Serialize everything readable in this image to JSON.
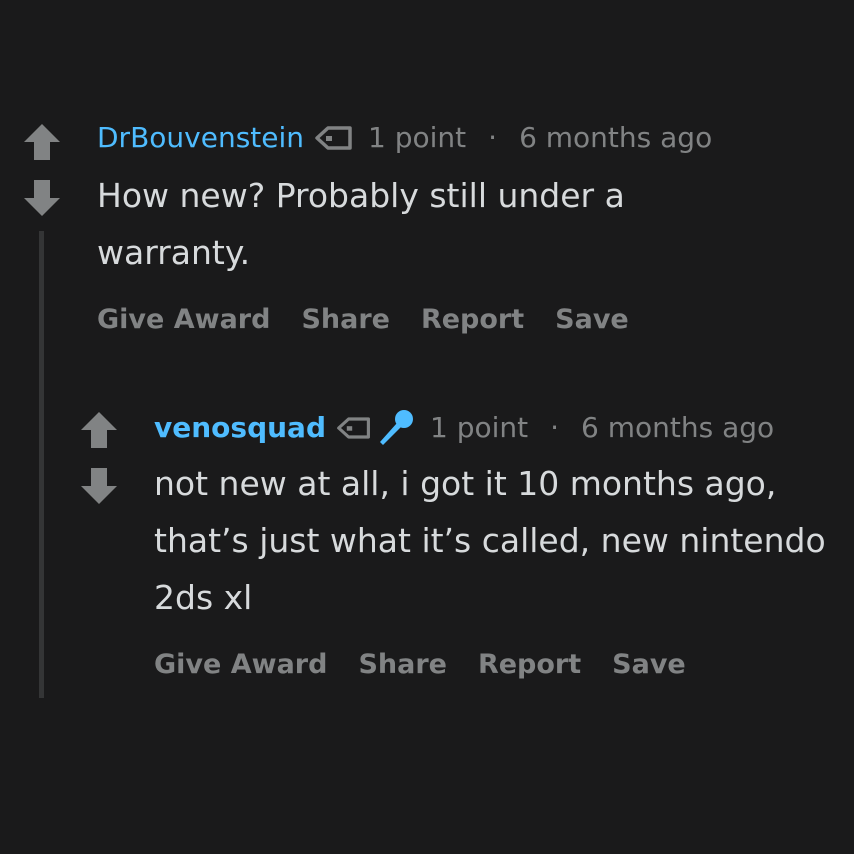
{
  "comments": [
    {
      "username": "DrBouvenstein",
      "points": "1 point",
      "separator": "·",
      "time": "6 months ago",
      "body": "How new? Probably still under a warranty.",
      "actions": [
        "Give Award",
        "Share",
        "Report",
        "Save"
      ],
      "icons": [
        "arrow-up-icon",
        "arrow-down-icon",
        "tag-icon"
      ]
    },
    {
      "username": "venosquad",
      "points": "1 point",
      "separator": "·",
      "time": "6 months ago",
      "body": "not new at all, i got it 10 months ago, that’s just what it’s called, new nintendo 2ds xl",
      "actions": [
        "Give Award",
        "Share",
        "Report",
        "Save"
      ],
      "icons": [
        "arrow-up-icon",
        "arrow-down-icon",
        "tag-icon",
        "microphone-icon"
      ]
    }
  ],
  "colors": {
    "background": "#1a1a1b",
    "username": "#4fbcff",
    "meta": "#818384",
    "body": "#d7dadc",
    "vote_arrow": "#818384",
    "thread_line": "#343536"
  }
}
